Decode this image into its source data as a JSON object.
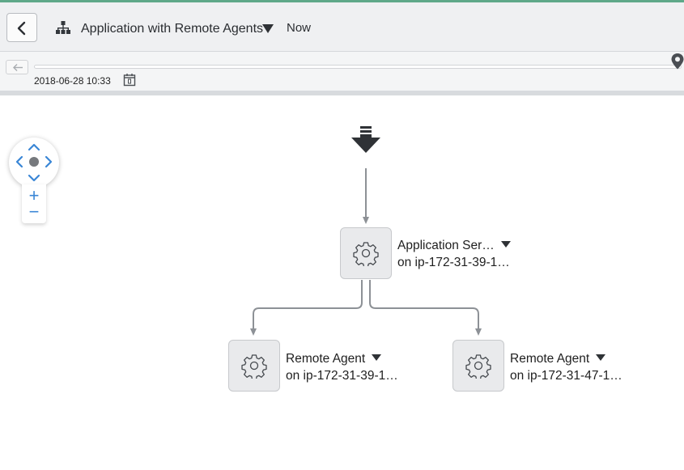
{
  "colors": {
    "accent": "#5fa889",
    "blue": "#3a86d6",
    "edge": "#8d9196"
  },
  "header": {
    "back_icon": "chevron-left-icon",
    "app_icon": "hierarchy-icon",
    "title": "Application with Remote Agents",
    "dropdown_icon": "caret-down-icon",
    "time_mode": "Now"
  },
  "timeline": {
    "back_icon": "arrow-left-icon",
    "marker_icon": "location-marker-icon",
    "date": "2018-06-28 10:33",
    "calendar_icon": "calendar-icon"
  },
  "controls": {
    "nav_icon": "pan-navigation-icon",
    "zoom_in": "+",
    "zoom_out": "−"
  },
  "graph": {
    "entry_icon": "download-arrow-icon",
    "nodes": [
      {
        "name": "Application Ser…",
        "host": "on ip-172-31-39-1…",
        "icon": "gear-icon"
      },
      {
        "name": "Remote Agent",
        "host": "on ip-172-31-39-1…",
        "icon": "gear-icon"
      },
      {
        "name": "Remote Agent",
        "host": "on ip-172-31-47-1…",
        "icon": "gear-icon"
      }
    ]
  }
}
